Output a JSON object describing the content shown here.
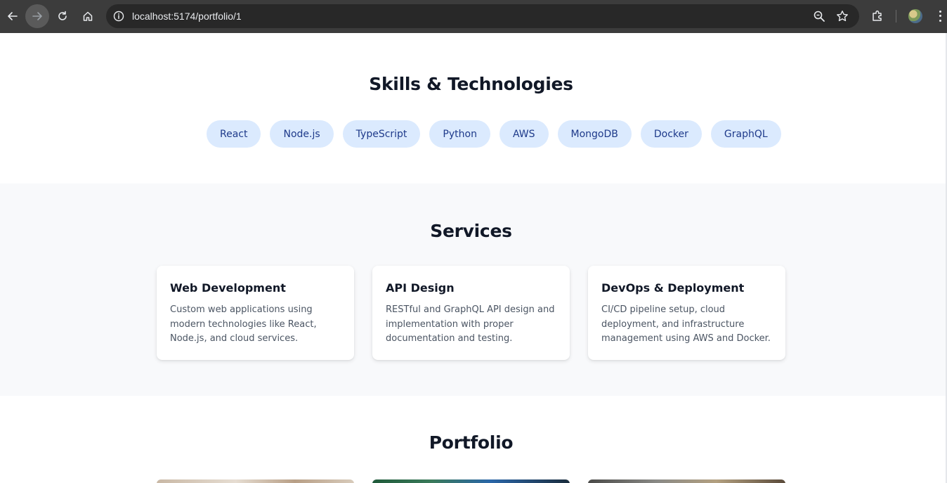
{
  "browser": {
    "url": "localhost:5174/portfolio/1"
  },
  "skills": {
    "title": "Skills & Technologies",
    "tags": [
      "React",
      "Node.js",
      "TypeScript",
      "Python",
      "AWS",
      "MongoDB",
      "Docker",
      "GraphQL"
    ]
  },
  "services": {
    "title": "Services",
    "cards": [
      {
        "title": "Web Development",
        "description": "Custom web applications using modern technologies like React, Node.js, and cloud services."
      },
      {
        "title": "API Design",
        "description": "RESTful and GraphQL API design and implementation with proper documentation and testing."
      },
      {
        "title": "DevOps & Deployment",
        "description": "CI/CD pipeline setup, cloud deployment, and infrastructure management using AWS and Docker."
      }
    ]
  },
  "portfolio": {
    "title": "Portfolio"
  },
  "colors": {
    "tag_bg": "#dbeafe",
    "tag_text": "#1e3a8a",
    "heading": "#111827",
    "body_text": "#4b5563",
    "section_alt_bg": "#f8f9fb"
  }
}
